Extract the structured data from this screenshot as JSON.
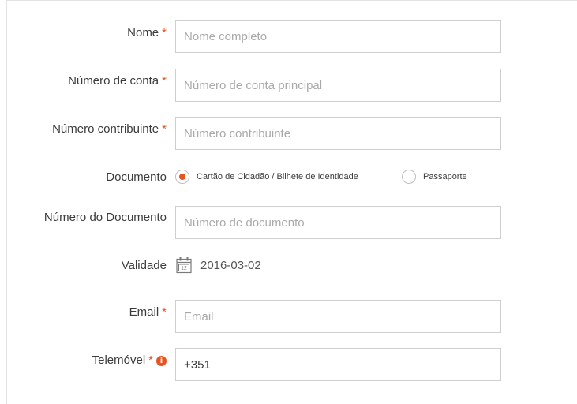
{
  "form": {
    "name": {
      "label": "Nome",
      "required_mark": "*",
      "placeholder": "Nome completo",
      "value": ""
    },
    "account": {
      "label": "Número de conta",
      "required_mark": "*",
      "placeholder": "Número de conta principal",
      "value": ""
    },
    "taxpayer": {
      "label": "Número contribuinte",
      "required_mark": "*",
      "placeholder": "Número contribuinte",
      "value": ""
    },
    "document": {
      "label": "Documento",
      "options": [
        {
          "label": "Cartão de Cidadão / Bilhete de Identidade",
          "selected": true
        },
        {
          "label": "Passaporte",
          "selected": false
        }
      ]
    },
    "document_number": {
      "label": "Número do Documento",
      "placeholder": "Número de documento",
      "value": ""
    },
    "validity": {
      "label": "Validade",
      "calendar_icon_day": "12",
      "value": "2016-03-02",
      "icon": "calendar-icon"
    },
    "email": {
      "label": "Email",
      "required_mark": "*",
      "placeholder": "Email",
      "value": ""
    },
    "phone": {
      "label": "Telemóvel",
      "required_mark": "*",
      "info_icon_glyph": "i",
      "value": "+351",
      "icon": "info-icon"
    }
  },
  "colors": {
    "accent": "#e8531f",
    "border": "#cfcfcf",
    "placeholder": "#a9a9a9",
    "text": "#3b3b3b"
  }
}
